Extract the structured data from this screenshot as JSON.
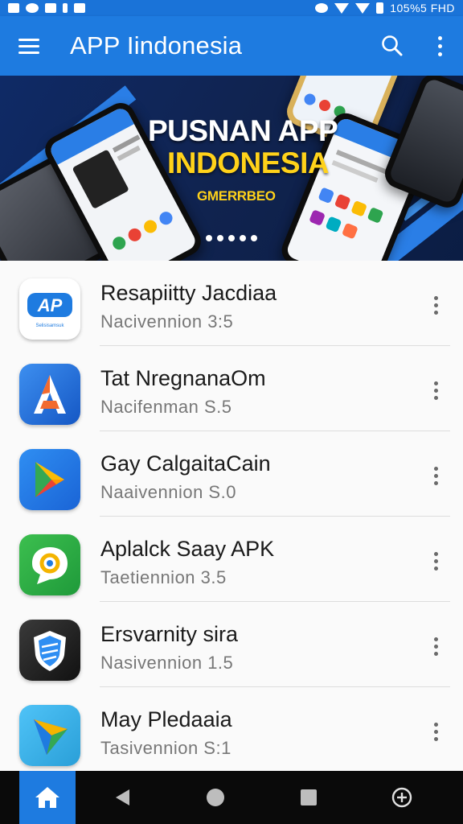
{
  "status_bar": {
    "right_text": "105%5 FHD",
    "icons": [
      "notification-icon",
      "cloud-icon",
      "image-icon",
      "bluetooth-icon",
      "battery-small-icon",
      "alarm-icon",
      "wifi-icon",
      "signal-icon",
      "battery-icon"
    ]
  },
  "header": {
    "title": "APP Iindonesia",
    "menu_icon": "hamburger-menu-icon",
    "search_icon": "search-icon",
    "overflow_icon": "more-vert-icon",
    "color": "#1e7be0"
  },
  "banner": {
    "line1": "PUSNAN APP",
    "line2": "INDONESIA",
    "tagline": "GMERRBEO",
    "slide_count": 5,
    "accent_color": "#ffd21a"
  },
  "apps": [
    {
      "name": "Resapiitty Jacdiaa",
      "meta": "Nacivennion 3:5",
      "icon": "ap-logo-icon",
      "icon_label": "AP",
      "icon_sublabel": "Selisisamsuk"
    },
    {
      "name": "Tat NregnanaOm",
      "meta": "Nacifenman S.5",
      "icon": "a-letter-icon"
    },
    {
      "name": "Gay CalgaitaCain",
      "meta": "Naaivennion S.0",
      "icon": "play-store-icon"
    },
    {
      "name": "Aplalck Saay APK",
      "meta": "Taetiennion 3.5",
      "icon": "chat-bubble-icon"
    },
    {
      "name": "Ersvarnity sira",
      "meta": "Nasivennion 1.5",
      "icon": "shield-icon"
    },
    {
      "name": "May Pledaaia",
      "meta": "Tasivennion S:1",
      "icon": "play-triangle-icon"
    }
  ],
  "bottom_nav": {
    "items": [
      "home-icon",
      "back-icon",
      "home-circle-icon",
      "recents-icon",
      "add-circle-icon"
    ],
    "active": "home-icon"
  }
}
